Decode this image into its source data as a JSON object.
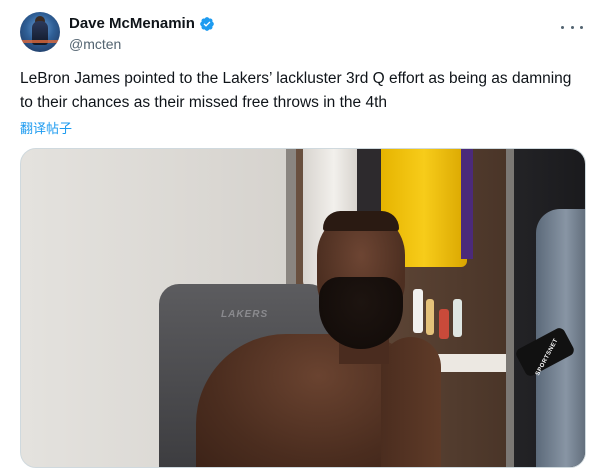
{
  "author": {
    "display_name": "Dave McMenamin",
    "handle": "@mcten",
    "verified": true,
    "verified_color": "#1d9bf0"
  },
  "tweet": {
    "text": "LeBron James pointed to the Lakers’ lackluster 3rd Q effort as being as damning to their chances as their missed free throws in the 4th",
    "translate_label": "翻译帖子"
  },
  "media": {
    "chair_logo_text": "LAKERS",
    "mic_flag_text": "SPORTSNET"
  },
  "icons": {
    "more": "more-horizontal-icon",
    "verified": "verified-badge-icon"
  },
  "colors": {
    "link": "#1d9bf0",
    "secondary_text": "#536471",
    "primary_text": "#0f1419"
  }
}
